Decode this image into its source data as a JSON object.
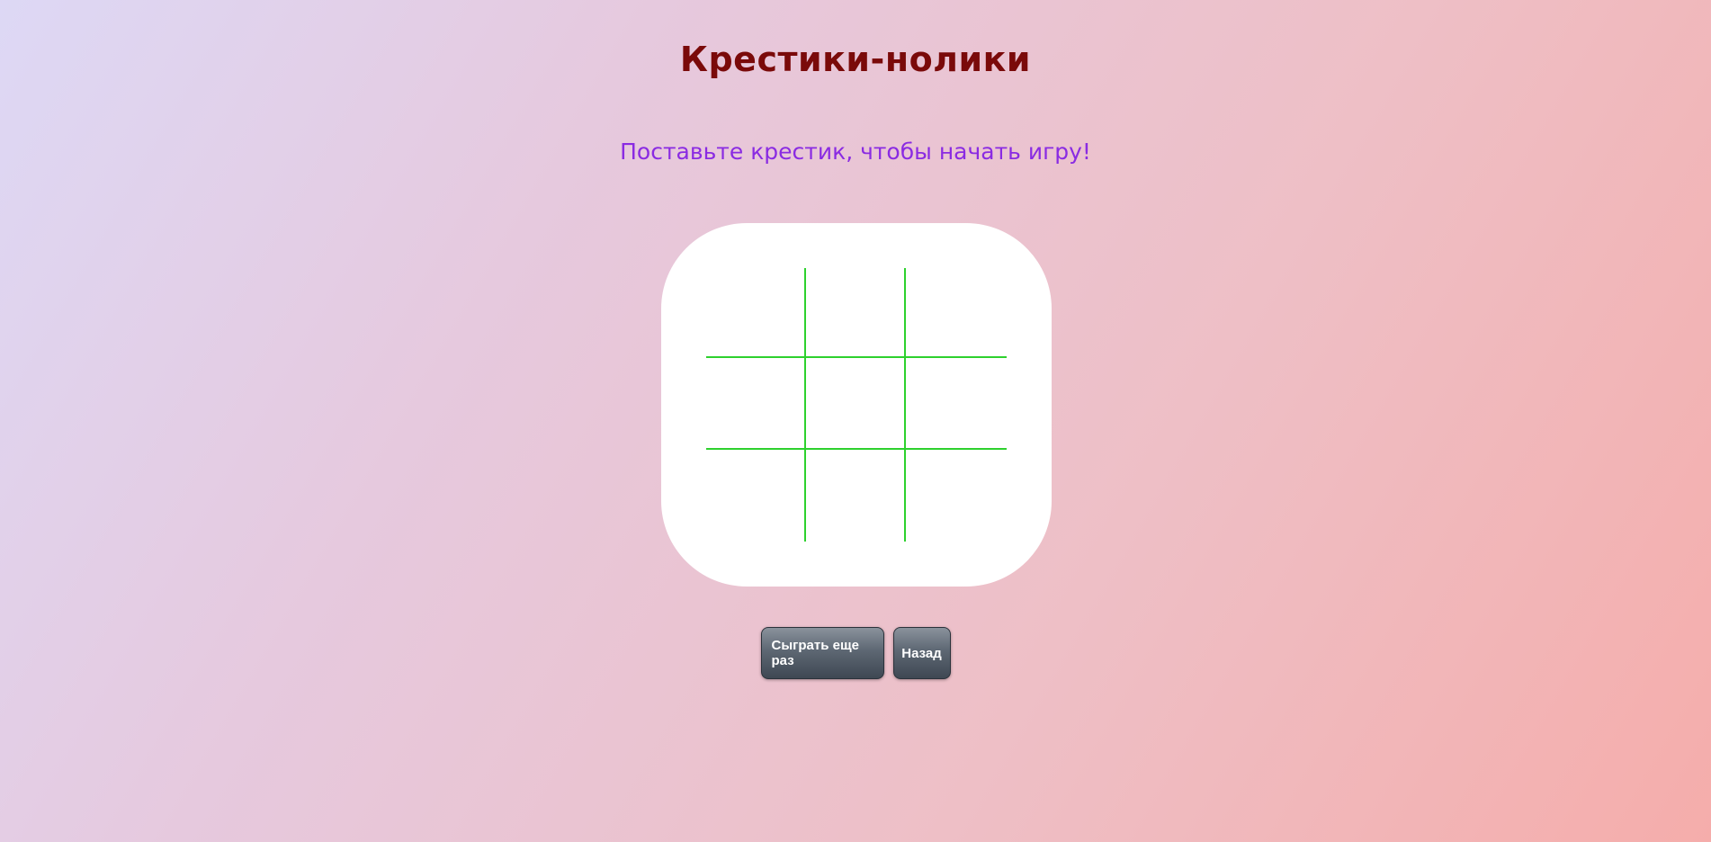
{
  "game": {
    "title": "Крестики-нолики",
    "status": "Поставьте крестик, чтобы начать игру!",
    "grid_color": "#2ed12e",
    "title_color": "#7a0a0a",
    "status_color": "#8a2be2",
    "cells": [
      "",
      "",
      "",
      "",
      "",
      "",
      "",
      "",
      ""
    ]
  },
  "buttons": {
    "play_again": "Сыграть еще раз",
    "back": "Назад"
  }
}
